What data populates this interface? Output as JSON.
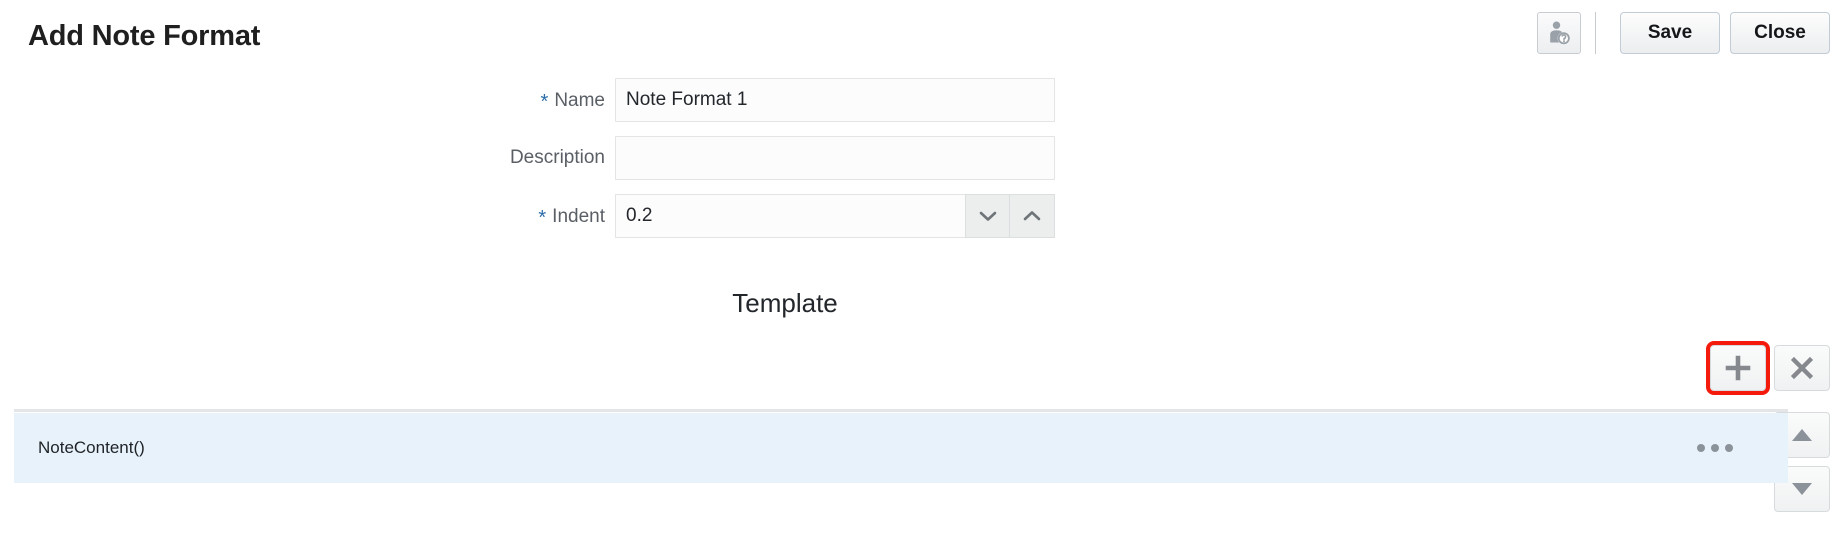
{
  "page": {
    "title": "Add Note Format"
  },
  "header": {
    "help_icon": "user-help-icon",
    "save_label": "Save",
    "close_label": "Close"
  },
  "form": {
    "required_marker": "*",
    "fields": [
      {
        "label": "Name",
        "required": true,
        "value": "Note Format 1",
        "placeholder": ""
      },
      {
        "label": "Description",
        "required": false,
        "value": "",
        "placeholder": ""
      },
      {
        "label": "Indent",
        "required": true,
        "value": "0.2",
        "placeholder": ""
      }
    ]
  },
  "template": {
    "heading": "Template",
    "toolbar": {
      "add_icon": "plus-icon",
      "delete_icon": "close-x-icon",
      "move_up_icon": "triangle-up-icon",
      "move_down_icon": "triangle-down-icon"
    },
    "rows": [
      {
        "label": "NoteContent()",
        "menu_icon": "ellipsis-icon"
      }
    ]
  },
  "colors": {
    "required_star": "#2c6ca8",
    "row_selected_bg": "#e8f2fa",
    "focus_outline": "#f51b0c"
  }
}
